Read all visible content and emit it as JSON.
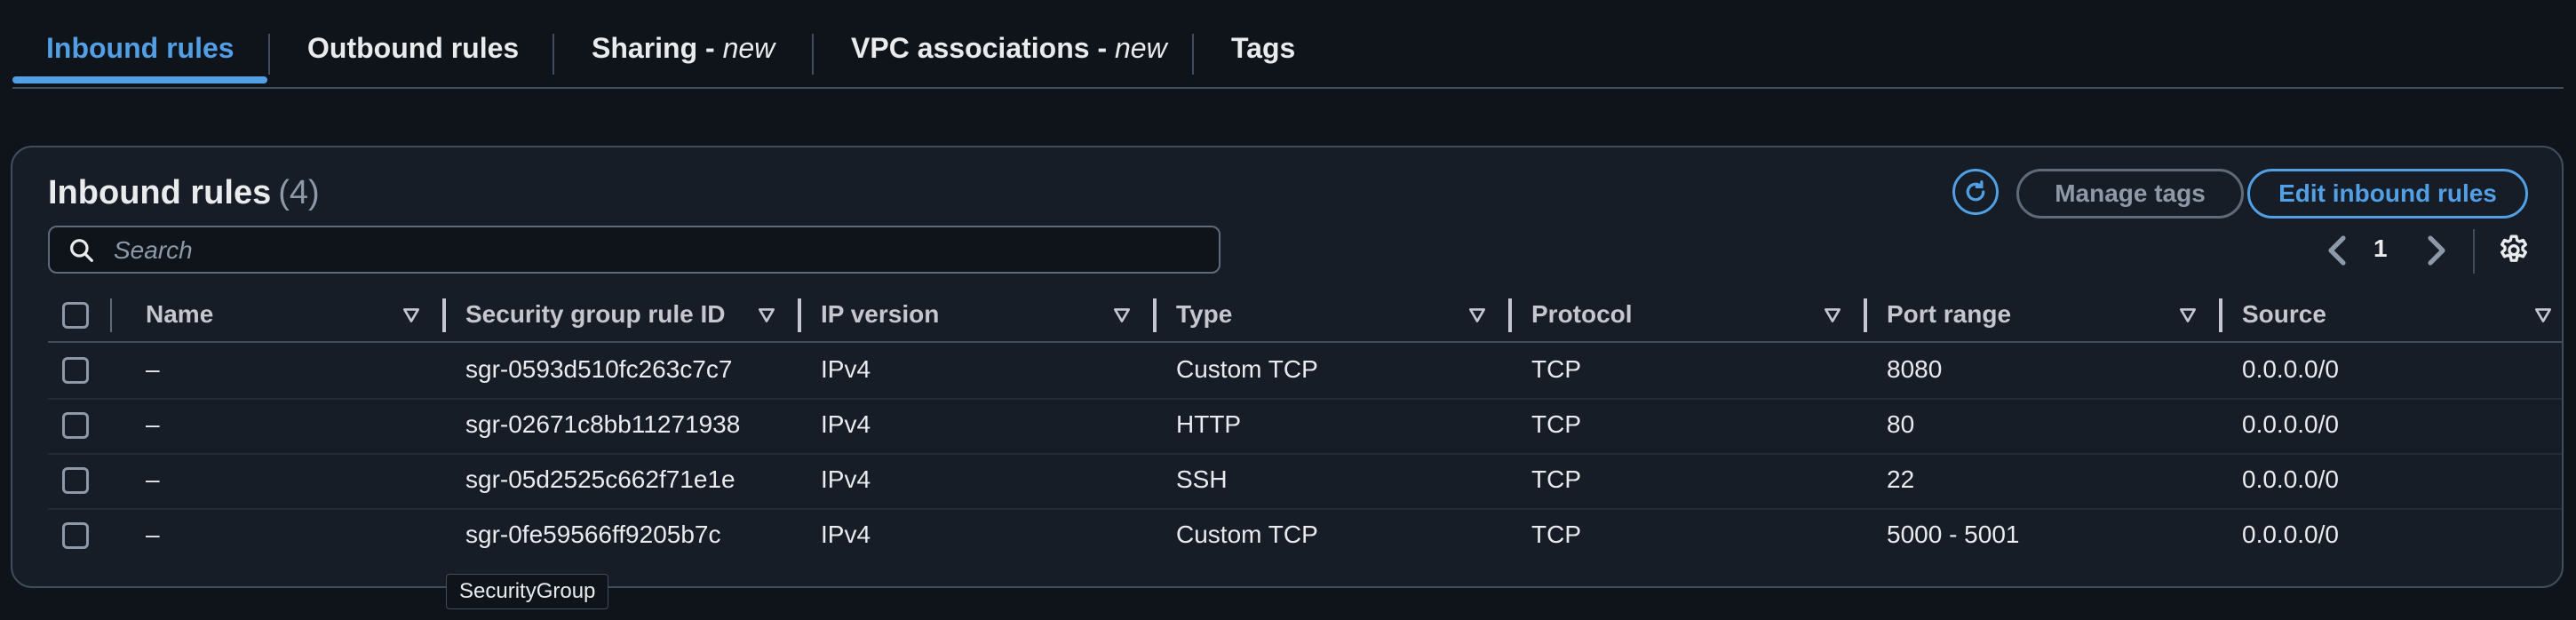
{
  "tabs": [
    {
      "label": "Inbound rules",
      "suffix": "",
      "active": true
    },
    {
      "label": "Outbound rules",
      "suffix": ""
    },
    {
      "label": "Sharing - ",
      "suffix": "new"
    },
    {
      "label": "VPC associations - ",
      "suffix": "new"
    },
    {
      "label": "Tags",
      "suffix": ""
    }
  ],
  "panel": {
    "title": "Inbound rules",
    "count": "(4)",
    "manage_tags_label": "Manage tags",
    "edit_label": "Edit inbound rules",
    "search_placeholder": "Search",
    "page": "1"
  },
  "table": {
    "columns": [
      "Name",
      "Security group rule ID",
      "IP version",
      "Type",
      "Protocol",
      "Port range",
      "Source"
    ],
    "rows": [
      [
        "–",
        "sgr-0593d510fc263c7c7",
        "IPv4",
        "Custom TCP",
        "TCP",
        "8080",
        "0.0.0.0/0"
      ],
      [
        "–",
        "sgr-02671c8bb11271938",
        "IPv4",
        "HTTP",
        "TCP",
        "80",
        "0.0.0.0/0"
      ],
      [
        "–",
        "sgr-05d2525c662f71e1e",
        "IPv4",
        "SSH",
        "TCP",
        "22",
        "0.0.0.0/0"
      ],
      [
        "–",
        "sgr-0fe59566ff9205b7c",
        "IPv4",
        "Custom TCP",
        "TCP",
        "5000 - 5001",
        "0.0.0.0/0"
      ]
    ]
  },
  "tooltip": "SecurityGroup",
  "colors": {
    "accent": "#539fe5",
    "background": "#0f141b",
    "panel": "#161d26",
    "border": "#414d5c"
  }
}
